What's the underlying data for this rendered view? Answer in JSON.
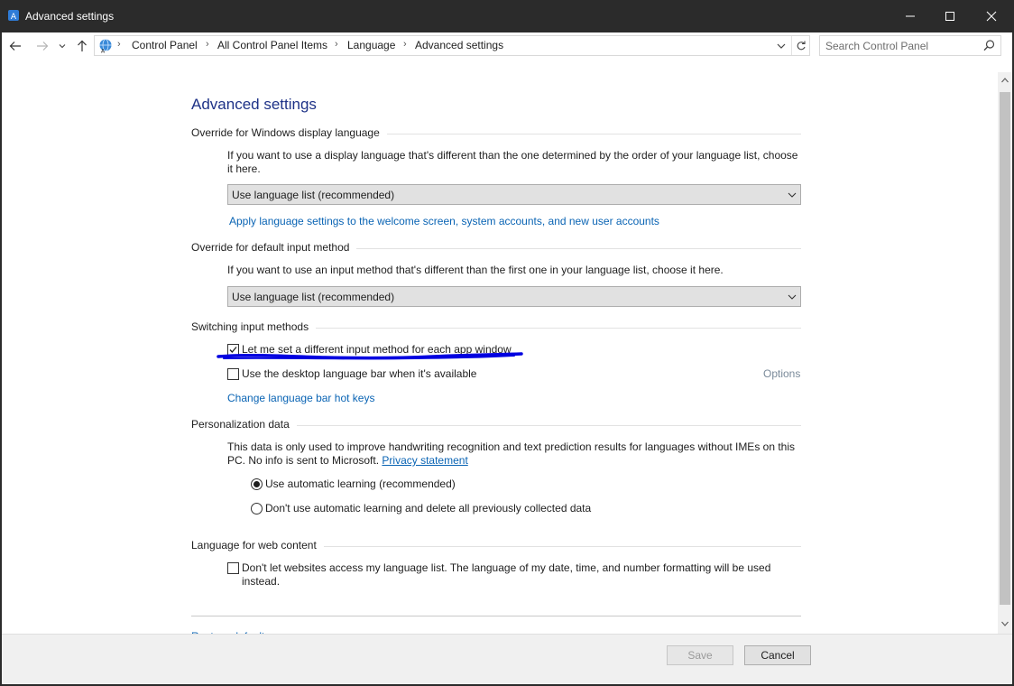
{
  "window": {
    "title": "Advanced settings",
    "minimize_icon": "minimize-icon",
    "maximize_icon": "maximize-icon",
    "close_icon": "close-icon"
  },
  "nav": {
    "breadcrumbs": [
      "Control Panel",
      "All Control Panel Items",
      "Language",
      "Advanced settings"
    ],
    "search_placeholder": "Search Control Panel"
  },
  "page": {
    "title": "Advanced settings",
    "display_language": {
      "heading": "Override for Windows display language",
      "description": "If you want to use a display language that's different than the one determined by the order of your language list, choose it here.",
      "selected": "Use language list (recommended)",
      "link": "Apply language settings to the welcome screen, system accounts, and new user accounts"
    },
    "input_method": {
      "heading": "Override for default input method",
      "description": "If you want to use an input method that's different than the first one in your language list, choose it here.",
      "selected": "Use language list (recommended)"
    },
    "switching": {
      "heading": "Switching input methods",
      "per_app_label": "Let me set a different input method for each app window",
      "per_app_checked": true,
      "language_bar_label": "Use the desktop language bar when it's available",
      "language_bar_checked": false,
      "options_link": "Options",
      "hotkeys_link": "Change language bar hot keys"
    },
    "personalization": {
      "heading": "Personalization data",
      "description": "This data is only used to improve handwriting recognition and text prediction results for languages without IMEs on this PC. No info is sent to Microsoft.",
      "privacy_link": "Privacy statement",
      "radio_auto": "Use automatic learning (recommended)",
      "radio_none": "Don't use automatic learning and delete all previously collected data",
      "selected": "auto"
    },
    "web_content": {
      "heading": "Language for web content",
      "checkbox_label_line1": "Don't let websites access my language list. The language of my date, time, and number formatting will be used",
      "checkbox_label_line2": "instead.",
      "checked": false
    },
    "restore_defaults": "Restore defaults"
  },
  "footer": {
    "save_label": "Save",
    "save_enabled": false,
    "cancel_label": "Cancel"
  },
  "colors": {
    "title_bar": "#2b2b2b",
    "heading_blue": "#1e3287",
    "link_blue": "#0a64b4",
    "annotation_ink": "#0000e0"
  }
}
